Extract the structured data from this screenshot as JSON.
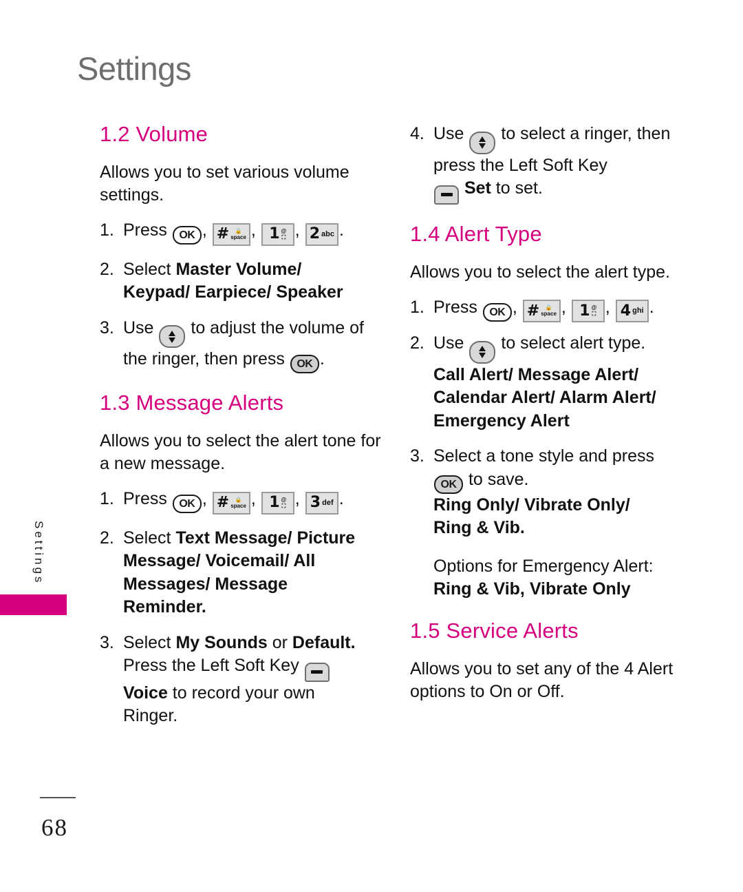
{
  "page": {
    "title": "Settings",
    "side_tab_label": "Settings",
    "number": "68"
  },
  "icons": {
    "ok": "OK",
    "hash_big": "#",
    "hash_sub_top": "lock",
    "hash_sub_bottom": "space",
    "one_big": "1",
    "one_sub_top": "@",
    "one_sub_bottom": "voicemail",
    "two_big": "2",
    "two_sub": "abc",
    "three_big": "3",
    "three_sub": "def",
    "four_big": "4",
    "four_sub": "ghi",
    "nav": "navigation-up-down",
    "soft": "left-soft-key"
  },
  "left_column": {
    "volume": {
      "heading": "1.2 Volume",
      "intro": "Allows you to set various volume settings.",
      "step1_num": "1.",
      "step1_pre": "Press",
      "step1_comma1": ",",
      "step1_comma2": ",",
      "step1_comma3": ",",
      "step1_end": ".",
      "step2_num": "2.",
      "step2_pre": "Select ",
      "step2_bold_a": "Master Volume/",
      "step2_bold_b": "Keypad/ Earpiece/ Speaker",
      "step3_num": "3.",
      "step3_pre": "Use",
      "step3_mid": "to adjust the volume of the ringer, then press",
      "step3_end": "."
    },
    "message_alerts": {
      "heading": "1.3 Message Alerts",
      "intro": "Allows you to select the alert tone for a new message.",
      "step1_num": "1.",
      "step1_pre": "Press",
      "step1_end": ".",
      "step2_num": "2.",
      "step2_pre": "Select ",
      "step2_bold_a": "Text Message/ Picture",
      "step2_bold_b": "Message/ Voicemail/ All",
      "step2_bold_c": "Messages/ Message",
      "step2_bold_d": "Reminder.",
      "step3_num": "3.",
      "step3_pre": "Select ",
      "step3_bold_a": "My Sounds",
      "step3_mid_a": " or ",
      "step3_bold_b": "Default.",
      "step3_line2": "Press the Left Soft Key",
      "step3_bold_c": "Voice",
      "step3_mid_b": " to record your own",
      "step3_line4": "Ringer."
    }
  },
  "right_column": {
    "volume_cont": {
      "step4_num": "4.",
      "step4_pre": "Use",
      "step4_mid": "to select a ringer, then press the Left Soft Key",
      "step4_bold": "Set",
      "step4_end": " to set."
    },
    "alert_type": {
      "heading": "1.4 Alert Type",
      "intro": "Allows you to select the alert type.",
      "step1_num": "1.",
      "step1_pre": "Press",
      "step1_end": ".",
      "step2_num": "2.",
      "step2_pre": "Use",
      "step2_mid": "to select alert type.",
      "step2_bold_a": "Call Alert/ Message Alert/",
      "step2_bold_b": "Calendar Alert/ Alarm Alert/",
      "step2_bold_c": "Emergency Alert",
      "step3_num": "3.",
      "step3_pre": "Select a tone style and press",
      "step3_mid": "to save.",
      "step3_bold_a": "Ring Only/ Vibrate Only/",
      "step3_bold_b": "Ring & Vib.",
      "emergency_label": "Options for Emergency Alert:",
      "emergency_bold": "Ring & Vib, Vibrate Only"
    },
    "service_alerts": {
      "heading": "1.5 Service Alerts",
      "intro": "Allows you to set any of the 4 Alert options to On or Off."
    }
  }
}
